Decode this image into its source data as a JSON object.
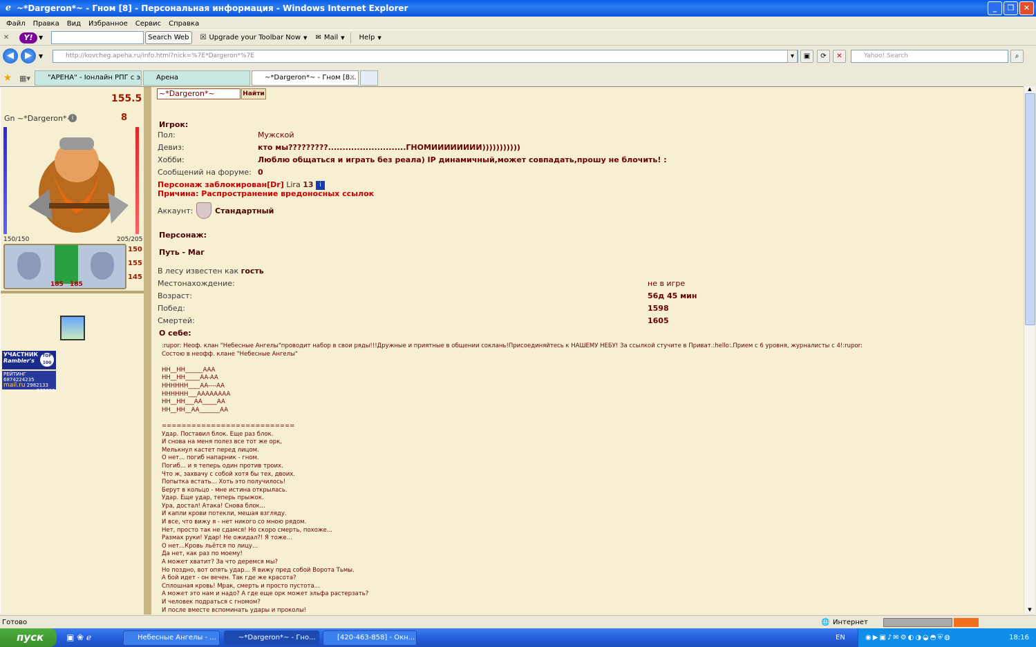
{
  "window": {
    "title": "~*Dargeron*~ - Гном [8] - Персональная информация - Windows Internet Explorer"
  },
  "menu": [
    "Файл",
    "Правка",
    "Вид",
    "Избранное",
    "Сервис",
    "Справка"
  ],
  "yahoo_toolbar": {
    "search_button": "Search Web",
    "upgrade": "Upgrade your Toolbar Now",
    "mail": "Mail",
    "help": "Help"
  },
  "address": {
    "url": "http://kovcheg.apeha.ru/info.html?nick=%7E*Dargeron*%7E",
    "yahoo_search_placeholder": "Yahoo! Search"
  },
  "tabs": [
    {
      "label": "\"АРЕНА\" - Іонлайн РПГ с эл..."
    },
    {
      "label": "Арена"
    },
    {
      "label": "~*Dargeron*~ - Гном [8..."
    }
  ],
  "sidebar": {
    "money": "155.5",
    "nick": "Gn ~*Dargeron*~",
    "level": "8",
    "hp": "150/150",
    "mana": "205/205",
    "stats": [
      "150",
      "155",
      "145"
    ],
    "bottom_vals": [
      "185",
      "185"
    ],
    "rambler_top": "УЧАСТНИК",
    "rambler_brand": "Rambler's",
    "rambler_badge": "TOP 100",
    "mail_rating": "РЕЙТИНГ",
    "mail_n1": "6874224235",
    "mail_brand": "mail.ru",
    "mail_n2": "2982133",
    "mail_n3": "232929"
  },
  "search": {
    "value": "~*Dargeron*~",
    "button": "Найти"
  },
  "player": {
    "header": "Игрок:",
    "gender_label": "Пол:",
    "gender": "Мужской",
    "motto_label": "Девиз:",
    "motto": "кто мы?????????...........................ГНОМИИИИИИИИ)))))))))))",
    "hobby_label": "Хобби:",
    "hobby": "Люблю общаться и играть без реала) IP динамичный,может совпадать,прошу не блочить! :",
    "posts_label": "Сообщений на форуме:",
    "posts": "0",
    "blocked_text": "Персонаж заблокирован[Dr]",
    "blocked_by": "Lira",
    "blocked_level": "13",
    "reason": "Причина: Распространение вредоносных ссылок",
    "account_label": "Аккаунт:",
    "account": "Стандартный"
  },
  "character": {
    "header": "Персонаж:",
    "path": "Путь - Маг",
    "forest_prefix": "В лесу известен как",
    "forest_status": "гость",
    "location_label": "Местонахождение:",
    "location": "не в игре",
    "age_label": "Возраст:",
    "age": "56д 45 мин",
    "wins_label": "Побед:",
    "wins": "1598",
    "deaths_label": "Смертей:",
    "deaths": "1605",
    "about_header": "О себе:"
  },
  "about_text": ":rupor: Неоф. клан \"Небесные Ангелы\"проводит набор в свои ряды!!!Дружные и приятные в общении соклань!Присоединяйтесь к НАШЕМУ НЕБУ! За ссылкой стучите в Приват.:hello:.Прием с 6 уровня, журналисты с 4!:rupor:\nСостою в неофф. клане \"Небесные Ангелы\"\n\nHH__HH______AAA\nHH__HH_____AA-AA\nHHHHHH____AA----AA\nHHHHHH___AAAAAAAA\nHH__HH___AA_____AA\nHH__HH__AA_______AA\n\n===========================\nУдар. Поставил блок. Еще раз блок.\nИ снова на меня полез все тот же орк,\nМелькнул кастет перед лицом.\nО нет... погиб напарник - гном.\nПогиб... и я теперь один против троих.\nЧто ж, захвачу с собой хотя бы тех, двоих.\nПопытка встать... Хоть это получилось!\nБерут в кольцо - мне истина открылась.\nУдар. Еще удар, теперь прыжок.\nУра, достал! Атака! Снова блок...\nИ капли крови потекли, мешая взгляду.\nИ все, что вижу я - нет никого со мною рядом.\nНет, просто так не сдамся! Но скоро смерть, похоже...\nРазмах руки! Удар! Не ожидал?! Я тоже...\nО нет...Кровь льётся по лицу...\nДа нет, как раз по моему!\nА может хватит? За что деремся мы?\nНо поздно, вот опять удар... Я вижу пред собой Ворота Тьмы.\nА бой идет - он вечен. Так где же красота?\nСплошная кровь! Мрак, смерть и просто пустота...\nА может это нам и надо? А где еще орк может эльфа растерзать?\nИ человек подраться с гномом?\nИ после вместе вспоминать удары и проколы!",
  "status": {
    "left": "Готово",
    "zone": "Интернет"
  },
  "taskbar": {
    "start": "пуск",
    "items": [
      "Небесные Ангелы - ...",
      "~*Dargeron*~ - Гно...",
      "[420-463-858] - Окн..."
    ],
    "lang": "EN",
    "time": "18:16"
  },
  "colors": {
    "accent_red": "#c80000",
    "text_dark_red": "#6b0000",
    "page_bg": "#f6efd1"
  }
}
